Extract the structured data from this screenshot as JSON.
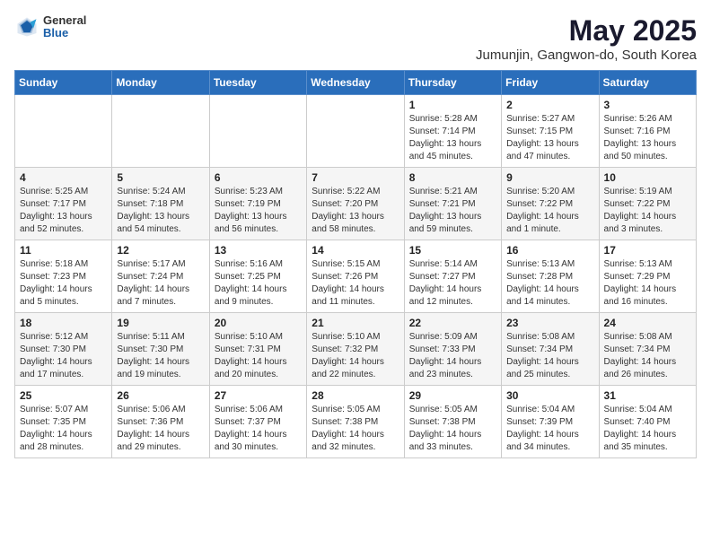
{
  "logo": {
    "general": "General",
    "blue": "Blue"
  },
  "title": "May 2025",
  "subtitle": "Jumunjin, Gangwon-do, South Korea",
  "weekdays": [
    "Sunday",
    "Monday",
    "Tuesday",
    "Wednesday",
    "Thursday",
    "Friday",
    "Saturday"
  ],
  "weeks": [
    [
      {
        "day": "",
        "info": ""
      },
      {
        "day": "",
        "info": ""
      },
      {
        "day": "",
        "info": ""
      },
      {
        "day": "",
        "info": ""
      },
      {
        "day": "1",
        "info": "Sunrise: 5:28 AM\nSunset: 7:14 PM\nDaylight: 13 hours\nand 45 minutes."
      },
      {
        "day": "2",
        "info": "Sunrise: 5:27 AM\nSunset: 7:15 PM\nDaylight: 13 hours\nand 47 minutes."
      },
      {
        "day": "3",
        "info": "Sunrise: 5:26 AM\nSunset: 7:16 PM\nDaylight: 13 hours\nand 50 minutes."
      }
    ],
    [
      {
        "day": "4",
        "info": "Sunrise: 5:25 AM\nSunset: 7:17 PM\nDaylight: 13 hours\nand 52 minutes."
      },
      {
        "day": "5",
        "info": "Sunrise: 5:24 AM\nSunset: 7:18 PM\nDaylight: 13 hours\nand 54 minutes."
      },
      {
        "day": "6",
        "info": "Sunrise: 5:23 AM\nSunset: 7:19 PM\nDaylight: 13 hours\nand 56 minutes."
      },
      {
        "day": "7",
        "info": "Sunrise: 5:22 AM\nSunset: 7:20 PM\nDaylight: 13 hours\nand 58 minutes."
      },
      {
        "day": "8",
        "info": "Sunrise: 5:21 AM\nSunset: 7:21 PM\nDaylight: 13 hours\nand 59 minutes."
      },
      {
        "day": "9",
        "info": "Sunrise: 5:20 AM\nSunset: 7:22 PM\nDaylight: 14 hours\nand 1 minute."
      },
      {
        "day": "10",
        "info": "Sunrise: 5:19 AM\nSunset: 7:22 PM\nDaylight: 14 hours\nand 3 minutes."
      }
    ],
    [
      {
        "day": "11",
        "info": "Sunrise: 5:18 AM\nSunset: 7:23 PM\nDaylight: 14 hours\nand 5 minutes."
      },
      {
        "day": "12",
        "info": "Sunrise: 5:17 AM\nSunset: 7:24 PM\nDaylight: 14 hours\nand 7 minutes."
      },
      {
        "day": "13",
        "info": "Sunrise: 5:16 AM\nSunset: 7:25 PM\nDaylight: 14 hours\nand 9 minutes."
      },
      {
        "day": "14",
        "info": "Sunrise: 5:15 AM\nSunset: 7:26 PM\nDaylight: 14 hours\nand 11 minutes."
      },
      {
        "day": "15",
        "info": "Sunrise: 5:14 AM\nSunset: 7:27 PM\nDaylight: 14 hours\nand 12 minutes."
      },
      {
        "day": "16",
        "info": "Sunrise: 5:13 AM\nSunset: 7:28 PM\nDaylight: 14 hours\nand 14 minutes."
      },
      {
        "day": "17",
        "info": "Sunrise: 5:13 AM\nSunset: 7:29 PM\nDaylight: 14 hours\nand 16 minutes."
      }
    ],
    [
      {
        "day": "18",
        "info": "Sunrise: 5:12 AM\nSunset: 7:30 PM\nDaylight: 14 hours\nand 17 minutes."
      },
      {
        "day": "19",
        "info": "Sunrise: 5:11 AM\nSunset: 7:30 PM\nDaylight: 14 hours\nand 19 minutes."
      },
      {
        "day": "20",
        "info": "Sunrise: 5:10 AM\nSunset: 7:31 PM\nDaylight: 14 hours\nand 20 minutes."
      },
      {
        "day": "21",
        "info": "Sunrise: 5:10 AM\nSunset: 7:32 PM\nDaylight: 14 hours\nand 22 minutes."
      },
      {
        "day": "22",
        "info": "Sunrise: 5:09 AM\nSunset: 7:33 PM\nDaylight: 14 hours\nand 23 minutes."
      },
      {
        "day": "23",
        "info": "Sunrise: 5:08 AM\nSunset: 7:34 PM\nDaylight: 14 hours\nand 25 minutes."
      },
      {
        "day": "24",
        "info": "Sunrise: 5:08 AM\nSunset: 7:34 PM\nDaylight: 14 hours\nand 26 minutes."
      }
    ],
    [
      {
        "day": "25",
        "info": "Sunrise: 5:07 AM\nSunset: 7:35 PM\nDaylight: 14 hours\nand 28 minutes."
      },
      {
        "day": "26",
        "info": "Sunrise: 5:06 AM\nSunset: 7:36 PM\nDaylight: 14 hours\nand 29 minutes."
      },
      {
        "day": "27",
        "info": "Sunrise: 5:06 AM\nSunset: 7:37 PM\nDaylight: 14 hours\nand 30 minutes."
      },
      {
        "day": "28",
        "info": "Sunrise: 5:05 AM\nSunset: 7:38 PM\nDaylight: 14 hours\nand 32 minutes."
      },
      {
        "day": "29",
        "info": "Sunrise: 5:05 AM\nSunset: 7:38 PM\nDaylight: 14 hours\nand 33 minutes."
      },
      {
        "day": "30",
        "info": "Sunrise: 5:04 AM\nSunset: 7:39 PM\nDaylight: 14 hours\nand 34 minutes."
      },
      {
        "day": "31",
        "info": "Sunrise: 5:04 AM\nSunset: 7:40 PM\nDaylight: 14 hours\nand 35 minutes."
      }
    ]
  ]
}
